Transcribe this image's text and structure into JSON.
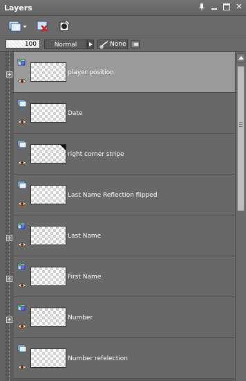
{
  "window": {
    "title": "Layers",
    "buttons": [
      "pin-icon",
      "minimize-icon",
      "maximize-icon",
      "close-icon"
    ],
    "close_glyph": "✕"
  },
  "toolbar": {
    "icons": [
      "new-layer-icon",
      "delete-layer-icon",
      "mask-icon"
    ]
  },
  "options": {
    "opacity": "100",
    "blend_mode": "Normal",
    "link": "None"
  },
  "layers": [
    {
      "name": "player position",
      "type": "group",
      "selected": true,
      "corner": false
    },
    {
      "name": "Date",
      "type": "raster",
      "selected": false,
      "corner": false
    },
    {
      "name": "right corner stripe",
      "type": "raster",
      "selected": false,
      "corner": true
    },
    {
      "name": "Last Name Reflection flipped",
      "type": "raster",
      "selected": false,
      "corner": false
    },
    {
      "name": "Last Name",
      "type": "group",
      "selected": false,
      "corner": false
    },
    {
      "name": "First Name",
      "type": "group",
      "selected": false,
      "corner": false
    },
    {
      "name": "Number",
      "type": "group",
      "selected": false,
      "corner": false
    },
    {
      "name": "Number refelection",
      "type": "raster",
      "selected": false,
      "corner": false
    }
  ],
  "colors": {
    "panel": "#5f5f5f",
    "selected_row": "#9a9a9a",
    "row": "#686868"
  }
}
